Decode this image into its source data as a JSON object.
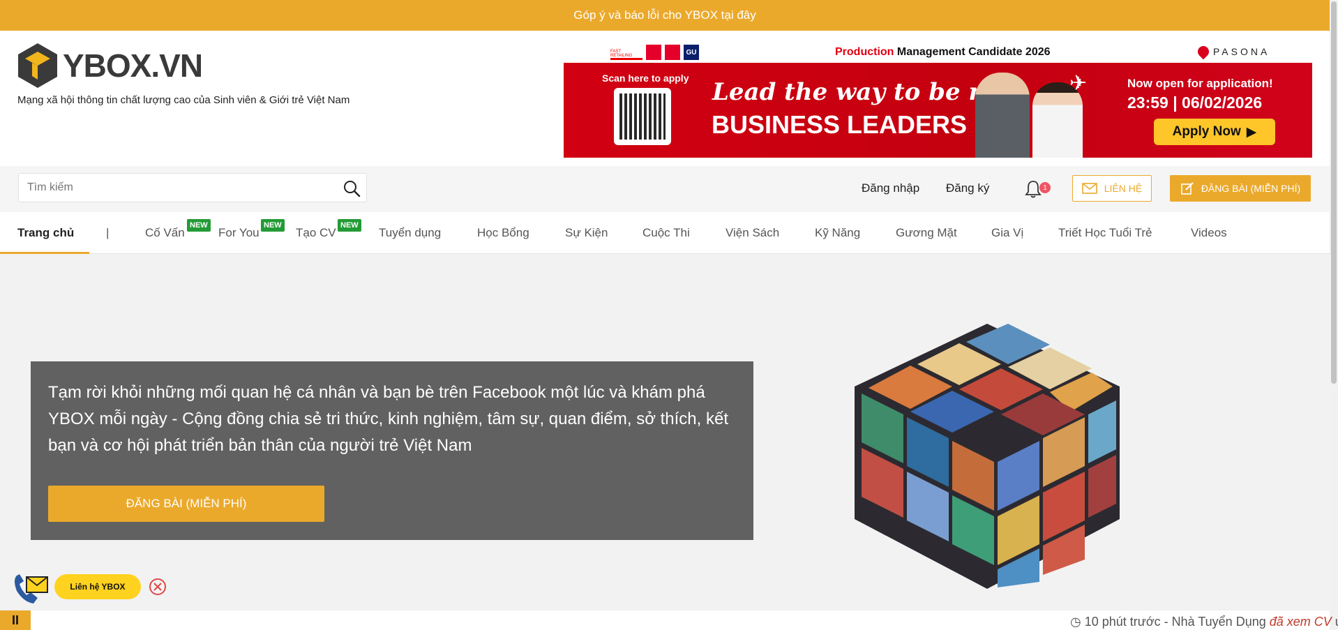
{
  "topbar": {
    "prefix": "Góp ý và báo lỗi cho YBOX ",
    "link": "tại đây"
  },
  "header": {
    "logo_text": "YBOX.VN",
    "tagline": "Mạng xã hội thông tin chất lượng cao của Sinh viên & Giới trẻ Việt Nam"
  },
  "ad": {
    "title_red": "Production",
    "title_rest": " Management Candidate 2026",
    "brand_fast": "FAST RETAILING",
    "brand_gu": "GU",
    "sponsor": "PASONA",
    "scan": "Scan here to apply",
    "lead": "Lead the way to be next",
    "headline": "BUSINESS LEADERS",
    "open": "Now open for application!",
    "date": "23:59 | 06/02/2026",
    "apply": "Apply Now"
  },
  "search": {
    "placeholder": "Tìm kiếm"
  },
  "account": {
    "login": "Đăng nhập",
    "register": "Đăng ký",
    "notification_count": "1",
    "contact": "LIÊN HỆ",
    "post": "ĐĂNG BÀI (MIỄN PHÍ)"
  },
  "nav": {
    "items": [
      {
        "label": "Trang chủ"
      },
      {
        "label": "|"
      },
      {
        "label": "Cố Vấn"
      },
      {
        "label": "For You"
      },
      {
        "label": "Tạo CV"
      },
      {
        "label": "Tuyển dụng"
      },
      {
        "label": "Học Bổng"
      },
      {
        "label": "Sự Kiện"
      },
      {
        "label": "Cuộc Thi"
      },
      {
        "label": "Viện Sách"
      },
      {
        "label": "Kỹ Năng"
      },
      {
        "label": "Gương Mặt"
      },
      {
        "label": "Gia Vị"
      },
      {
        "label": "Triết Học Tuổi Trẻ"
      },
      {
        "label": "Videos"
      }
    ],
    "new_badge": "NEW"
  },
  "hero": {
    "text": "Tạm rời khỏi những mối quan hệ cá nhân và bạn bè trên Facebook một lúc và khám phá YBOX mỗi ngày - Cộng đồng chia sẻ tri thức, kinh nghiệm, tâm sự, quan điểm, sở thích, kết bạn và cơ hội phát triển bản thân của người trẻ Việt Nam",
    "button": "ĐĂNG BÀI (MIỄN PHÍ)"
  },
  "float_contact": {
    "label": "Liên hệ YBOX"
  },
  "ticker": {
    "pause": "II",
    "time": "10 phút trước",
    "sep": " - Nhà Tuyển Dụng ",
    "action": "đã xem CV",
    "tail": " ứn"
  },
  "colors": {
    "accent": "#eba92b",
    "new_badge": "#239b35",
    "banner_red": "#d10012"
  }
}
